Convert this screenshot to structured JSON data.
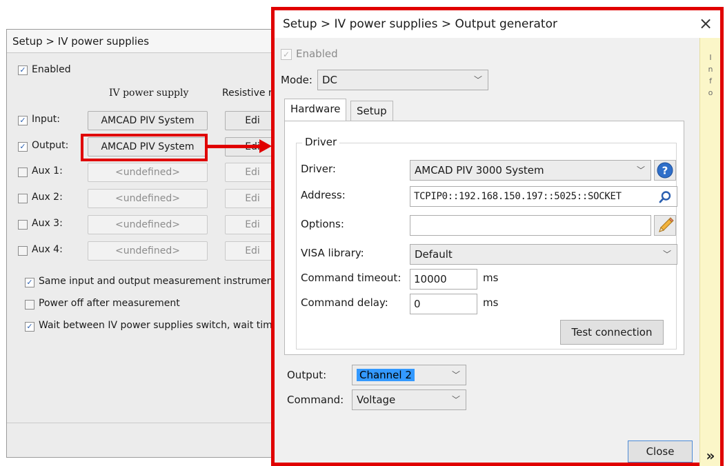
{
  "back_window": {
    "title": "Setup > IV power supplies",
    "enabled_label": "Enabled",
    "col_iv_supply": "IV power supply",
    "col_resistive": "Resistive r",
    "rows": [
      {
        "label": "Input:",
        "checked": true,
        "supply": "AMCAD PIV System",
        "edit": "Edi",
        "disabled": false
      },
      {
        "label": "Output:",
        "checked": true,
        "supply": "AMCAD PIV System",
        "edit": "Edi",
        "disabled": false
      },
      {
        "label": "Aux 1:",
        "checked": false,
        "supply": "<undefined>",
        "edit": "Edi",
        "disabled": true
      },
      {
        "label": "Aux 2:",
        "checked": false,
        "supply": "<undefined>",
        "edit": "Edi",
        "disabled": true
      },
      {
        "label": "Aux 3:",
        "checked": false,
        "supply": "<undefined>",
        "edit": "Edi",
        "disabled": true
      },
      {
        "label": "Aux 4:",
        "checked": false,
        "supply": "<undefined>",
        "edit": "Edi",
        "disabled": true
      }
    ],
    "opt_same_instrument": "Same input and output measurement instrument",
    "opt_power_off": "Power off after measurement",
    "opt_wait_between": "Wait between IV power supplies switch, wait time"
  },
  "front_window": {
    "title": "Setup > IV power supplies > Output generator",
    "close_glyph": "×",
    "enabled_label": "Enabled",
    "mode_label": "Mode:",
    "mode_value": "DC",
    "tabs": {
      "hardware": "Hardware",
      "setup": "Setup"
    },
    "driver_group_label": "Driver",
    "driver_label": "Driver:",
    "driver_value": "AMCAD PIV 3000 System",
    "address_label": "Address:",
    "address_value": "TCPIP0::192.168.150.197::5025::SOCKET",
    "options_label": "Options:",
    "options_value": "",
    "visa_label": "VISA library:",
    "visa_value": "Default",
    "timeout_label": "Command timeout:",
    "timeout_value": "10000",
    "timeout_unit": "ms",
    "delay_label": "Command delay:",
    "delay_value": "0",
    "delay_unit": "ms",
    "test_connection_label": "Test connection",
    "output_label": "Output:",
    "output_value": "Channel 2",
    "command_label": "Command:",
    "command_value": "Voltage",
    "close_button_label": "Close",
    "info_letters": "I n f o",
    "info_expand": "»"
  },
  "colors": {
    "highlight": "#e00000",
    "info_panel": "#fbf6c8",
    "selection": "#3399ff"
  }
}
